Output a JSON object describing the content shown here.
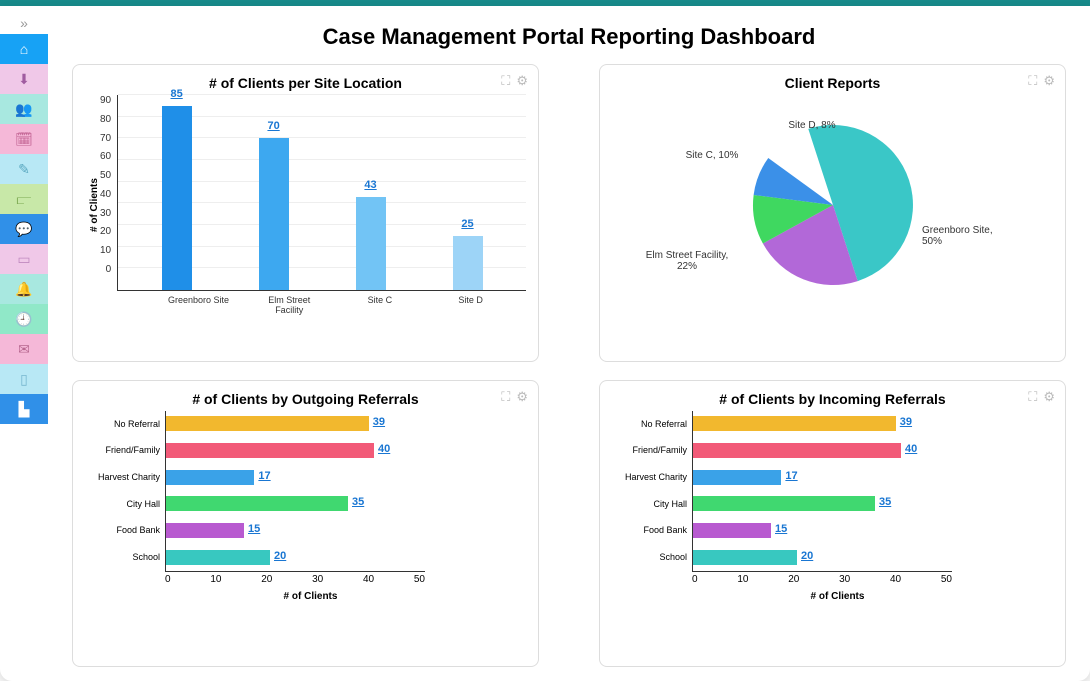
{
  "title": "Case Management Portal Reporting Dashboard",
  "sidebar": {
    "items": [
      {
        "name": "home-icon",
        "bg": "#17a2f5",
        "fg": "#fff"
      },
      {
        "name": "download-icon",
        "bg": "#f0c8e8",
        "fg": "#a05ca0"
      },
      {
        "name": "users-icon",
        "bg": "#a8e8e0",
        "fg": "#4aa89a"
      },
      {
        "name": "calendar-icon",
        "bg": "#f5b8d8",
        "fg": "#c06090"
      },
      {
        "name": "user-check-icon",
        "bg": "#b8e8f5",
        "fg": "#5aa8c0"
      },
      {
        "name": "chart-icon",
        "bg": "#c8e8a8",
        "fg": "#7aa850"
      },
      {
        "name": "comment-icon",
        "bg": "#3090e8",
        "fg": "#fff"
      },
      {
        "name": "contacts-icon",
        "bg": "#f0c8e8",
        "fg": "#c08ac0"
      },
      {
        "name": "bell-icon",
        "bg": "#a8e8e0",
        "fg": "#60b8a8"
      },
      {
        "name": "clock-icon",
        "bg": "#90e8c8",
        "fg": "#40a880"
      },
      {
        "name": "mail-icon",
        "bg": "#f5b8d8",
        "fg": "#b86890"
      },
      {
        "name": "id-icon",
        "bg": "#b8e8f5",
        "fg": "#78b8d0"
      },
      {
        "name": "sitemap-icon",
        "bg": "#3090e8",
        "fg": "#fff"
      }
    ]
  },
  "cards": {
    "clients_per_site": {
      "title": "# of Clients per Site Location",
      "ylabel": "# of Clients"
    },
    "client_reports": {
      "title": "Client Reports"
    },
    "outgoing": {
      "title": "# of Clients by Outgoing Referrals",
      "xlabel": "# of Clients"
    },
    "incoming": {
      "title": "# of Clients by Incoming Referrals",
      "xlabel": "# of Clients"
    }
  },
  "chart_data": [
    {
      "id": "clients_per_site",
      "type": "bar",
      "orientation": "vertical",
      "title": "# of Clients per Site Location",
      "categories": [
        "Greenboro Site",
        "Elm Street Facility",
        "Site C",
        "Site D"
      ],
      "values": [
        85,
        70,
        43,
        25
      ],
      "colors": [
        "#1f8fe8",
        "#3da8f0",
        "#72c4f5",
        "#9dd4f7"
      ],
      "ylabel": "# of Clients",
      "ylim": [
        0,
        90
      ],
      "yticks": [
        0,
        10,
        20,
        30,
        40,
        50,
        60,
        70,
        80,
        90
      ]
    },
    {
      "id": "client_reports",
      "type": "pie",
      "title": "Client Reports",
      "slices": [
        {
          "label": "Greenboro Site",
          "percent": 50,
          "color": "#3ac7c7"
        },
        {
          "label": "Elm Street Facility",
          "percent": 22,
          "color": "#b268d8"
        },
        {
          "label": "Site C",
          "percent": 10,
          "color": "#3fd860"
        },
        {
          "label": "Site D",
          "percent": 8,
          "color": "#3b90e8"
        }
      ],
      "labels": [
        "Greenboro Site, 50%",
        "Elm Street Facility, 22%",
        "Site C, 10%",
        "Site D, 8%"
      ]
    },
    {
      "id": "outgoing",
      "type": "bar",
      "orientation": "horizontal",
      "title": "# of Clients by Outgoing Referrals",
      "categories": [
        "No Referral",
        "Friend/Family",
        "Harvest Charity",
        "City Hall",
        "Food Bank",
        "School"
      ],
      "values": [
        39,
        40,
        17,
        35,
        15,
        20
      ],
      "colors": [
        "#f2b82e",
        "#f25a78",
        "#3aa2e8",
        "#40d870",
        "#b85ad0",
        "#38c8c0"
      ],
      "xlabel": "# of Clients",
      "xlim": [
        0,
        50
      ],
      "xticks": [
        0,
        10,
        20,
        30,
        40,
        50
      ]
    },
    {
      "id": "incoming",
      "type": "bar",
      "orientation": "horizontal",
      "title": "# of Clients by Incoming Referrals",
      "categories": [
        "No Referral",
        "Friend/Family",
        "Harvest Charity",
        "City Hall",
        "Food Bank",
        "School"
      ],
      "values": [
        39,
        40,
        17,
        35,
        15,
        20
      ],
      "colors": [
        "#f2b82e",
        "#f25a78",
        "#3aa2e8",
        "#40d870",
        "#b85ad0",
        "#38c8c0"
      ],
      "xlabel": "# of Clients",
      "xlim": [
        0,
        50
      ],
      "xticks": [
        0,
        10,
        20,
        30,
        40,
        50
      ]
    }
  ]
}
